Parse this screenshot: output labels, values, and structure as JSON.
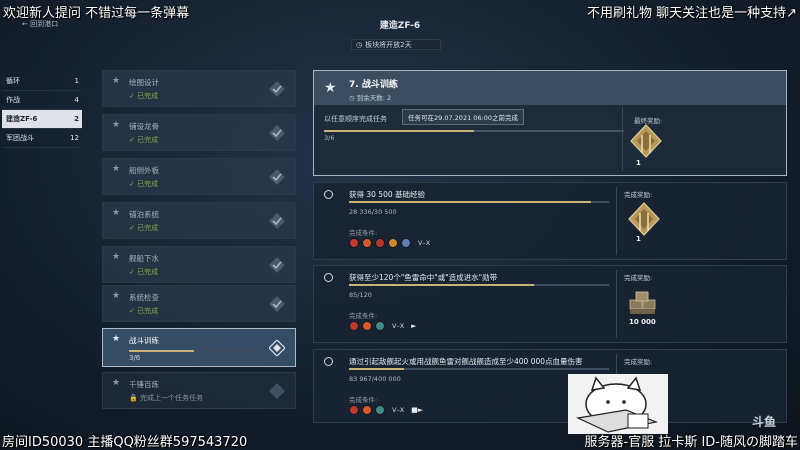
{
  "overlay": {
    "top_left": "欢迎新人提问 不错过每一条弹幕",
    "top_right": "不用刷礼物 聊天关注也是一种支持↗",
    "bottom_left": "房间ID50030 主播QQ粉丝群597543720",
    "bottom_right": "服务器-官服 拉卡斯 ID-随风の脚踏车",
    "watermark": "斗鱼"
  },
  "header": {
    "back_label": "回到港口",
    "title": "建造ZF-6",
    "notice": "板块将开放2天"
  },
  "menu": [
    {
      "label": "循环",
      "count": "1"
    },
    {
      "label": "作战",
      "count": "4"
    },
    {
      "label": "建造ZF-6",
      "count": "2"
    },
    {
      "label": "军团战斗",
      "count": "12"
    }
  ],
  "chain": [
    {
      "name": "绘图设计",
      "status": "已完成"
    },
    {
      "name": "铺设龙骨",
      "status": "已完成"
    },
    {
      "name": "船侧外板",
      "status": "已完成"
    },
    {
      "name": "锚泊系统",
      "status": "已完成"
    },
    {
      "name": "舰船下水",
      "status": "已完成"
    },
    {
      "name": "系统检查",
      "status": "已完成"
    },
    {
      "name": "战斗训练",
      "progress": "3/6",
      "progress_value": 0.5
    },
    {
      "name": "千锤百炼",
      "status": "完成上一个任务任务"
    }
  ],
  "detail": {
    "name": "7. 战斗训练",
    "days": "到余天数: 2",
    "description": "以任意顺序完成任务",
    "tooltip": "任务可在29.07.2021 06:00之前完成",
    "progress": "3/6",
    "progress_value": 0.5,
    "final_reward_label": "最终奖励:",
    "final_reward_qty": "1"
  },
  "objectives": [
    {
      "title": "获得 30 500 基础经验",
      "progress": "28 336/30 500",
      "progress_value": 0.93,
      "cond_label": "完成条件:",
      "cond_text": "V–X",
      "icons": [
        "#c0392b",
        "#d65a2a",
        "#b5362a",
        "#c98a2a",
        "#5a7fb3"
      ],
      "reward_label": "完成奖励:",
      "reward_qty": "1",
      "reward_type": "emblem"
    },
    {
      "title": "获得至少120个\"鱼雷命中\"或\"造成进水\"勋带",
      "progress": "85/120",
      "progress_value": 0.71,
      "cond_label": "完成条件:",
      "cond_text": "V–X",
      "flag": "►",
      "icons": [
        "#c0392b",
        "#d65a2a",
        "#3f8a8a"
      ],
      "reward_label": "完成奖励:",
      "reward_qty": "10 000",
      "reward_type": "crates"
    },
    {
      "title": "通过引起敌舰起火或用战舰鱼雷对舰战舰造成至少400 000点血量伤害",
      "progress": "83 967/400 000",
      "progress_value": 0.21,
      "cond_label": "完成条件:",
      "cond_text": "V–X",
      "flag": "■►",
      "icons": [
        "#c0392b",
        "#d65a2a",
        "#3f8a8a"
      ],
      "reward_label": "完成奖励:",
      "reward_qty": "",
      "reward_type": "none"
    }
  ],
  "colors": {
    "accent_gold": "#c9b37a",
    "complete_green": "#7fae3e",
    "panel": "#1e2b3a"
  }
}
